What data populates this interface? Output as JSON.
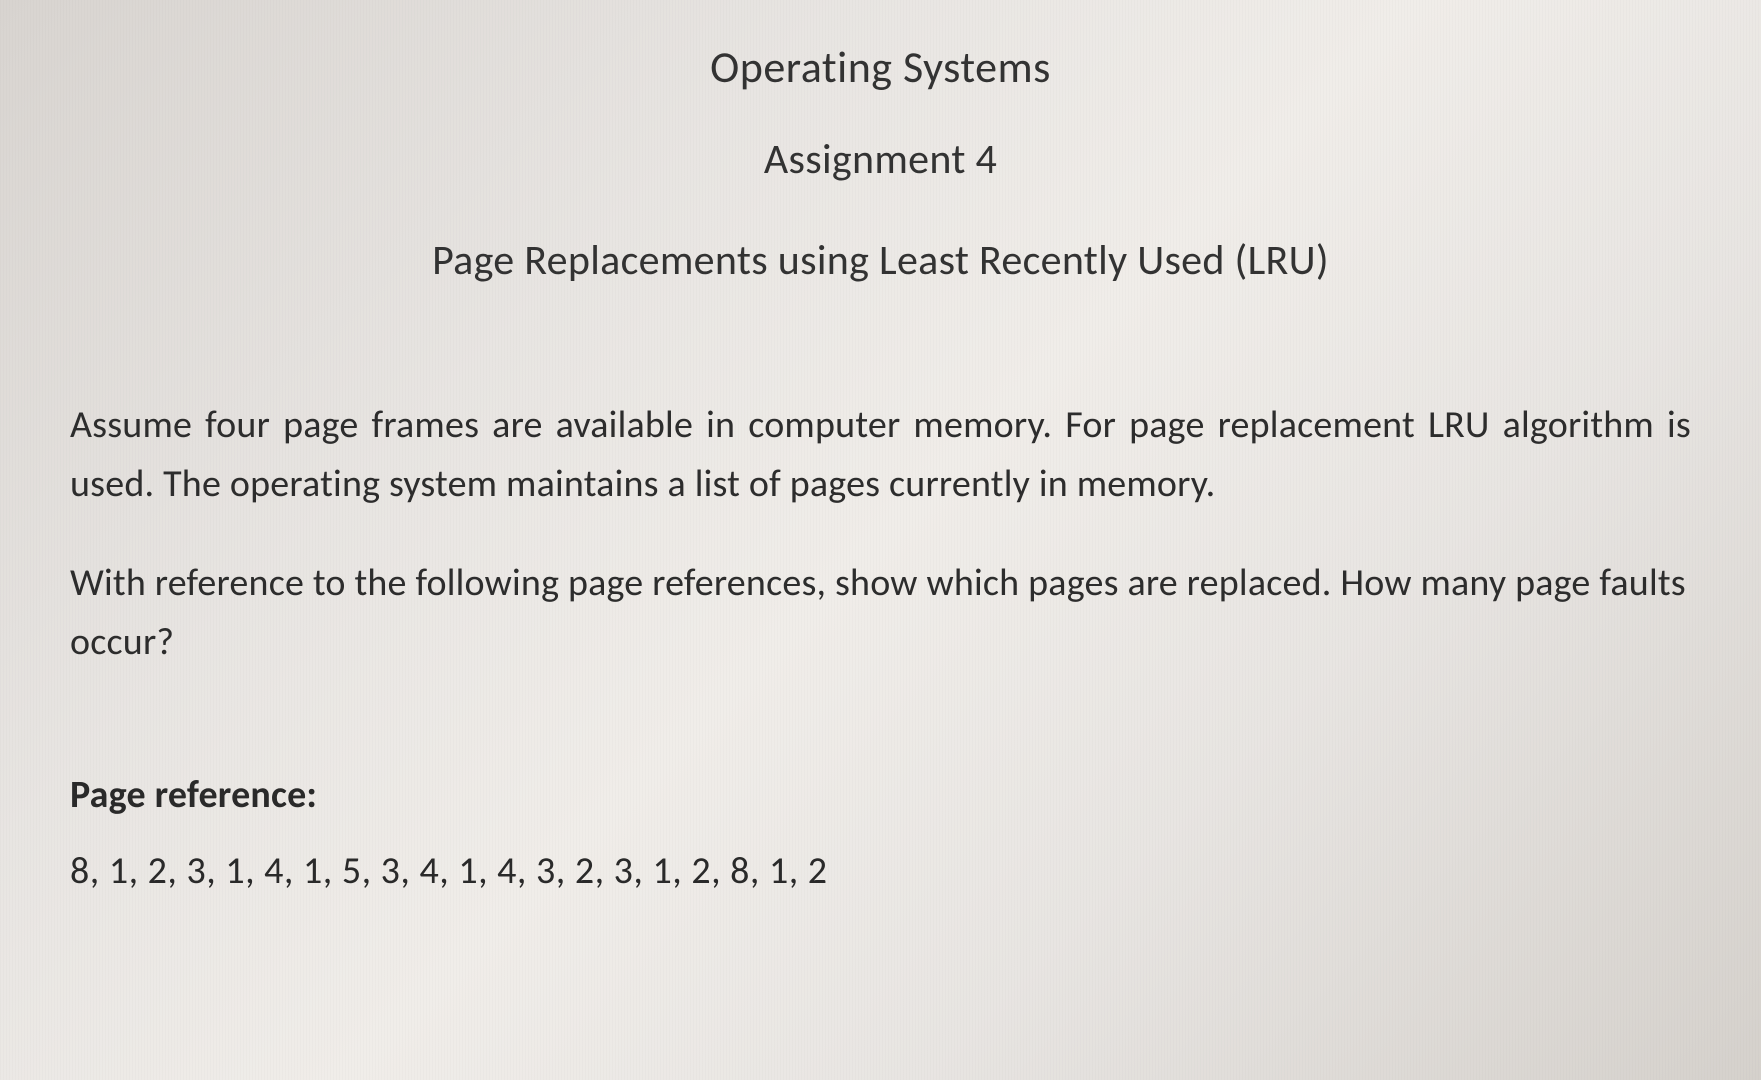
{
  "header": {
    "course_title": "Operating Systems",
    "assignment_title": "Assignment 4",
    "topic_title": "Page Replacements using Least Recently Used (LRU)"
  },
  "paragraphs": {
    "p1": "Assume four page frames are available in computer memory. For page replacement LRU algorithm is used. The operating system maintains a list of pages currently in memory.",
    "p2": "With reference to the following page references, show which pages are replaced. How many page faults occur?"
  },
  "page_reference": {
    "label": "Page reference:",
    "values": "8, 1, 2, 3, 1, 4, 1, 5, 3, 4, 1, 4, 3, 2, 3, 1, 2, 8, 1, 2"
  }
}
